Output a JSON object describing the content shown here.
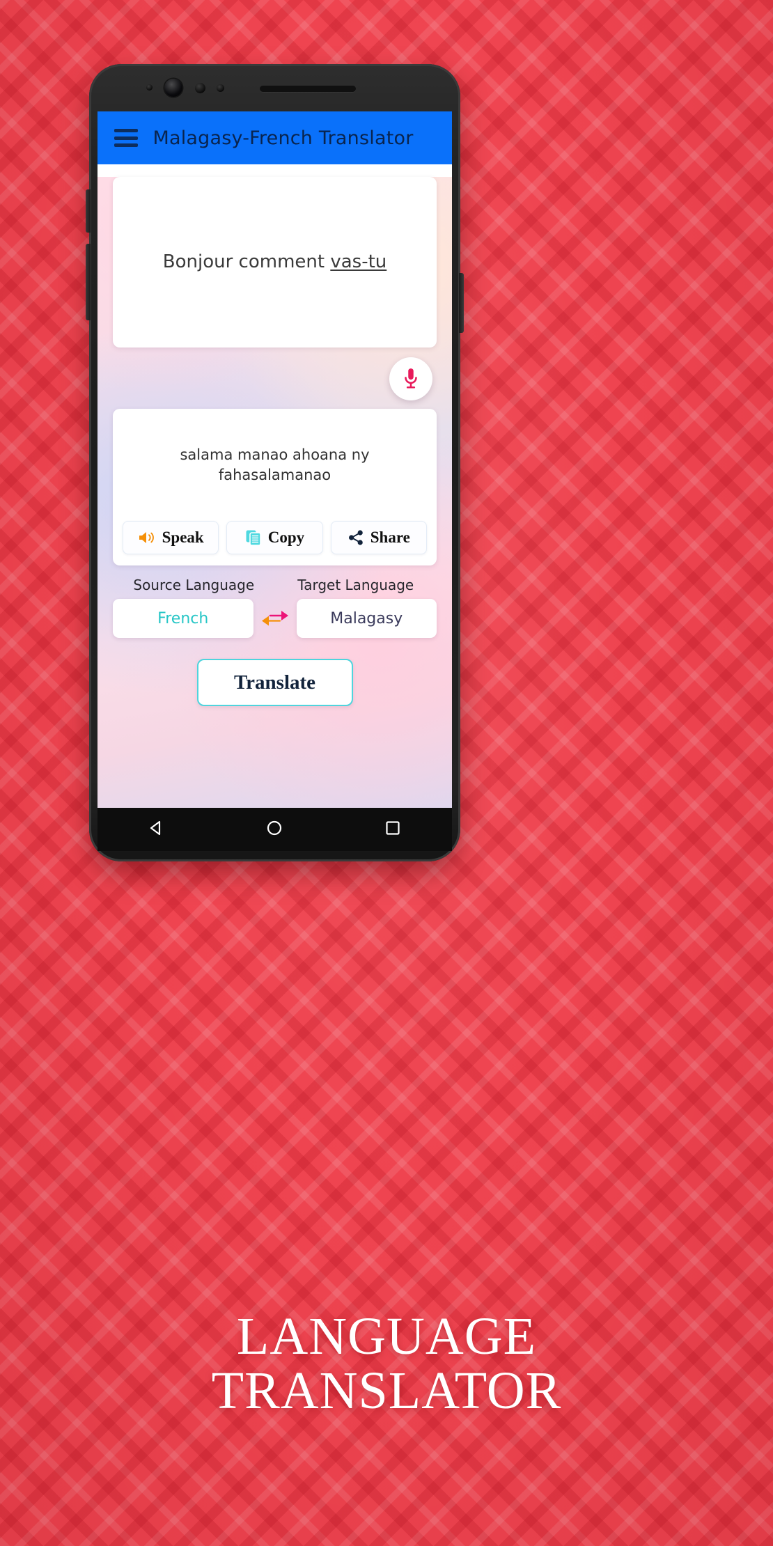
{
  "caption": {
    "line1": "LANGUAGE",
    "line2": "TRANSLATOR"
  },
  "phone": {
    "sensors": [
      "led-indicator",
      "front-camera",
      "proximity-sensor",
      "light-sensor",
      "earpiece-speaker"
    ]
  },
  "app": {
    "title": "Malagasy-French Translator",
    "menu_icon": "hamburger-menu-icon",
    "appbar_color": "#0a71fa",
    "appbar_text_color": "#09244e"
  },
  "source": {
    "text_before": "Bonjour comment ",
    "text_highlight": "vas-tu",
    "full_text": "Bonjour comment vas-tu"
  },
  "mic": {
    "icon": "microphone-icon",
    "color": "#e8195a"
  },
  "result": {
    "text": "salama manao ahoana ny fahasalamanao"
  },
  "actions": [
    {
      "label": "Speak",
      "icon": "speaker-volume-icon",
      "color": "#f59009"
    },
    {
      "label": "Copy",
      "icon": "copy-document-icon",
      "color": "#4fd8e0"
    },
    {
      "label": "Share",
      "icon": "share-nodes-icon",
      "color": "#12233b"
    }
  ],
  "languages": {
    "source_label": "Source Language",
    "target_label": "Target Language",
    "source_value": "French",
    "target_value": "Malagasy",
    "source_value_color": "#26c6c6",
    "target_value_color": "#3b3b5c",
    "swap_icon": "swap-arrows-icon",
    "swap_left_arrow_color": "#f59009",
    "swap_right_arrow_color": "#ec1478"
  },
  "translate": {
    "label": "Translate",
    "border_color": "#4fd4dd"
  },
  "navbar": {
    "back": "back-triangle-icon",
    "home": "home-circle-icon",
    "recents": "recents-square-icon"
  },
  "theme": {
    "background_red": "#ef4450",
    "card_white": "#ffffff"
  }
}
